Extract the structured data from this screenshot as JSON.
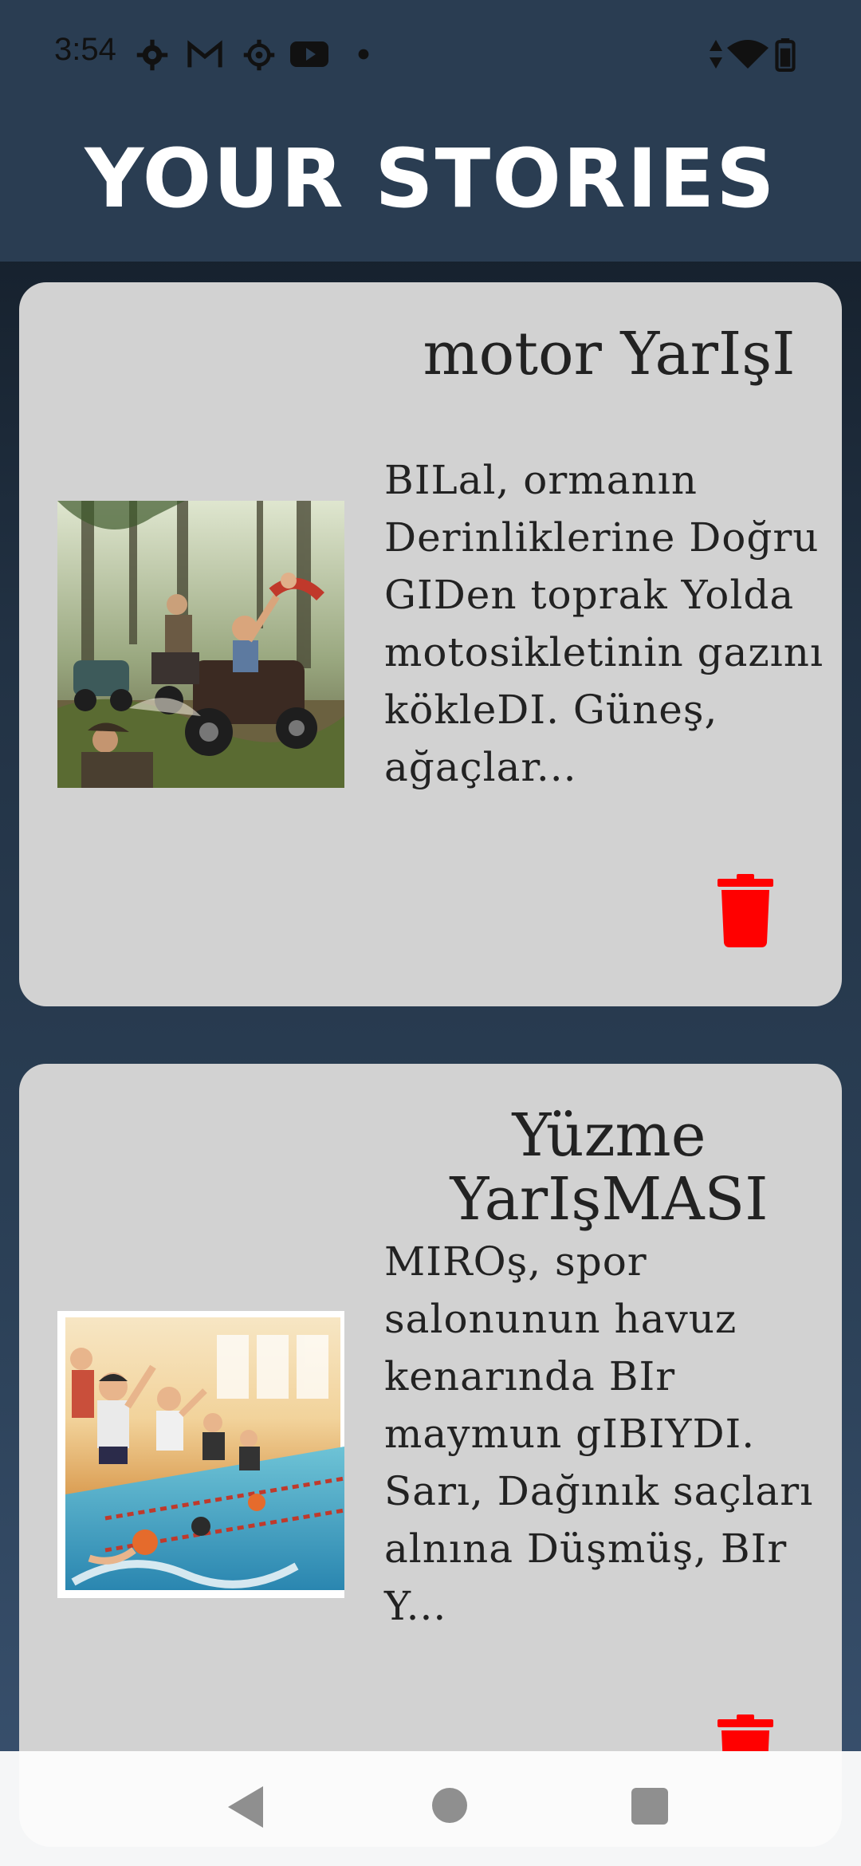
{
  "status_bar": {
    "time": "3:54",
    "icons": [
      "gear-icon",
      "gmail-icon",
      "gear-icon",
      "youtube-icon",
      "dot-icon"
    ],
    "right_icons": [
      "data-arrows-icon",
      "wifi-icon",
      "battery-icon"
    ]
  },
  "header": {
    "title": "YOUR STORIES"
  },
  "stories": [
    {
      "title": "motor YarIşI",
      "excerpt": "BILal, ormanın Derinliklerine Doğru GIDen toprak Yolda motosikletinin gazını kökleDI. Güneş, ağaçlar...",
      "image": "racing-illustration",
      "delete_icon": "trash-icon"
    },
    {
      "title": "Yüzme YarIşMASI",
      "excerpt": "MIROş, spor salonunun havuz kenarında BIr maymun gIBIYDI. Sarı, Dağınık saçları alnına Düşmüş, BIr Y...",
      "image": "swimming-illustration",
      "delete_icon": "trash-icon"
    }
  ],
  "nav": {
    "back": "back-icon",
    "home": "home-icon",
    "recents": "recents-icon"
  },
  "colors": {
    "header_bg": "#2a3d52",
    "card_bg": "#d2d2d2",
    "delete": "#ff0000"
  }
}
